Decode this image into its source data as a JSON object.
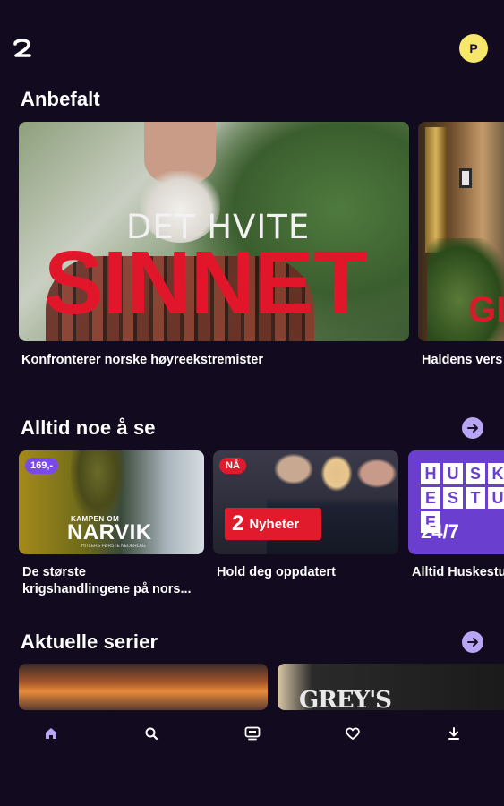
{
  "header": {
    "logo": "tv2-logo-icon",
    "avatar_initial": "P"
  },
  "sections": {
    "anbefalt": {
      "title": "Anbefalt",
      "items": [
        {
          "caption": "Konfronterer norske høyreekstremister",
          "image_title_top": "DET HVITE",
          "image_title_main": "SINNET"
        },
        {
          "caption": "Haldens vers",
          "image_title_main": "GI"
        }
      ]
    },
    "alltid": {
      "title": "Alltid noe å se",
      "items": [
        {
          "caption_line1": "De største",
          "caption_line2": "krigshandlingene på nors...",
          "badge": "169,-",
          "image_top": "KAMPEN OM",
          "image_title": "NARVIK",
          "image_sub": "HITLERS FØRSTE NEDERLAG"
        },
        {
          "caption": "Hold deg oppdatert",
          "badge": "NÅ",
          "logo_num": "2",
          "logo_text": "Nyheter"
        },
        {
          "caption": "Alltid Huskestu",
          "letters": [
            "H",
            "U",
            "S",
            "K",
            "E",
            "S",
            "T",
            "U",
            "E"
          ],
          "image_title": "24/7"
        }
      ]
    },
    "aktuelle": {
      "title": "Aktuelle serier",
      "items": [
        {
          "image_title": ""
        },
        {
          "image_title": "GREY'S ANATOMY"
        }
      ]
    }
  },
  "bottom_nav": [
    {
      "name": "home-icon",
      "active": true
    },
    {
      "name": "search-icon",
      "active": false
    },
    {
      "name": "tv-icon",
      "active": false
    },
    {
      "name": "heart-icon",
      "active": false
    },
    {
      "name": "download-icon",
      "active": false
    }
  ],
  "colors": {
    "background": "#120a1f",
    "accent": "#b9a5f5",
    "red": "#e21b2c",
    "purple": "#6a3fd0",
    "avatar": "#f6e66a"
  }
}
